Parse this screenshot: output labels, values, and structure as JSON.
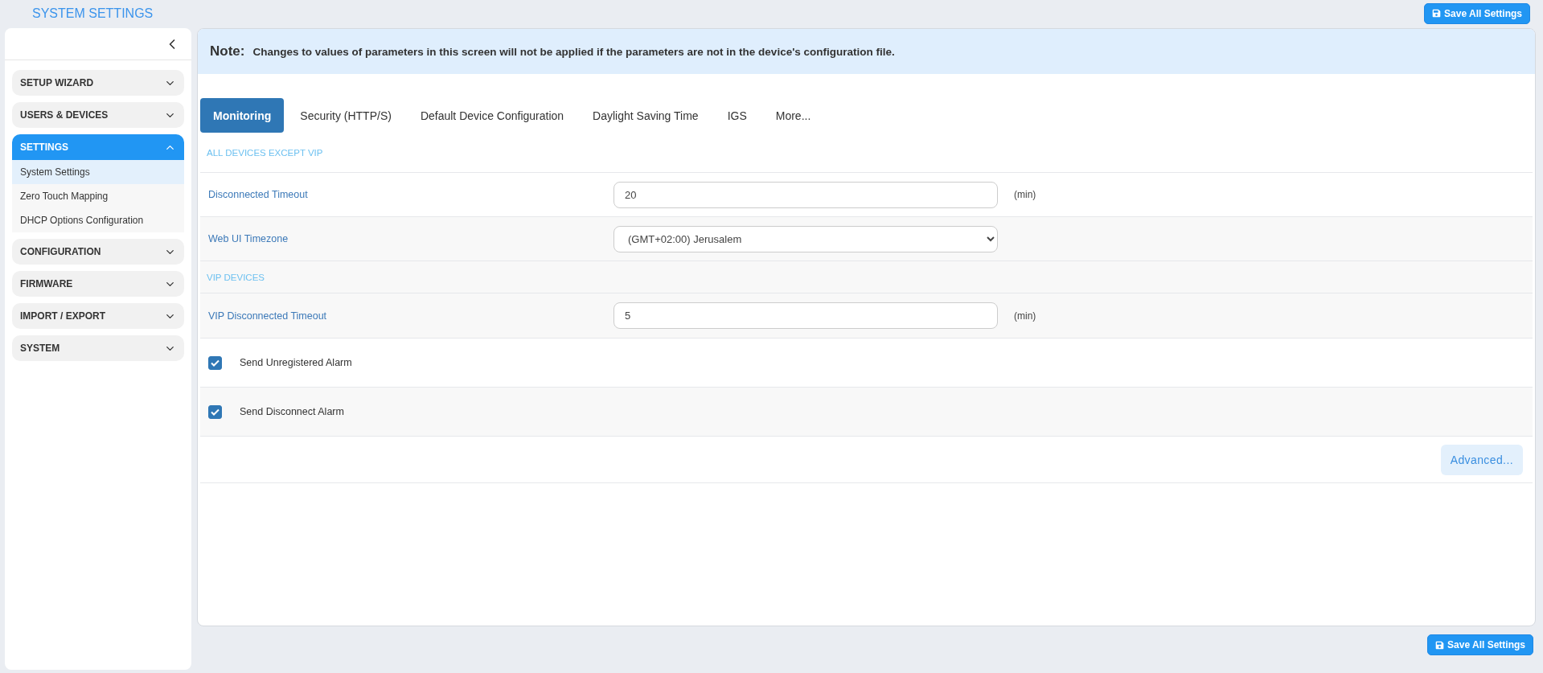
{
  "title": "SYSTEM SETTINGS",
  "save_top": "Save All Settings",
  "sidebar": {
    "groups": [
      {
        "label": "SETUP WIZARD",
        "expanded": false
      },
      {
        "label": "USERS & DEVICES",
        "expanded": false
      },
      {
        "label": "SETTINGS",
        "expanded": true,
        "items": [
          {
            "label": "System Settings",
            "selected": true
          },
          {
            "label": "Zero Touch Mapping",
            "selected": false
          },
          {
            "label": "DHCP Options Configuration",
            "selected": false
          }
        ]
      },
      {
        "label": "CONFIGURATION",
        "expanded": false
      },
      {
        "label": "FIRMWARE",
        "expanded": false
      },
      {
        "label": "IMPORT / EXPORT",
        "expanded": false
      },
      {
        "label": "SYSTEM",
        "expanded": false
      }
    ]
  },
  "note": {
    "label": "Note:",
    "text": "Changes to values of parameters in this screen will not be applied if the parameters are not in the device's configuration file."
  },
  "tabs": [
    {
      "label": "Monitoring",
      "selected": true
    },
    {
      "label": "Security (HTTP/S)",
      "selected": false
    },
    {
      "label": "Default Device Configuration",
      "selected": false
    },
    {
      "label": "Daylight Saving Time",
      "selected": false
    },
    {
      "label": "IGS",
      "selected": false
    },
    {
      "label": "More...",
      "selected": false
    }
  ],
  "rows": [
    {
      "kind": "section",
      "label": "ALL DEVICES EXCEPT VIP"
    },
    {
      "kind": "input",
      "label": "Disconnected Timeout",
      "value": "20",
      "unit": "(min)"
    },
    {
      "kind": "select",
      "label": "Web UI Timezone",
      "value": "(GMT+02:00) Jerusalem"
    },
    {
      "kind": "section",
      "label": "VIP DEVICES"
    },
    {
      "kind": "input",
      "label": "VIP Disconnected Timeout",
      "value": "5",
      "unit": "(min)"
    },
    {
      "kind": "checkbox",
      "label": "Send Unregistered Alarm",
      "checked": true
    },
    {
      "kind": "checkbox",
      "label": "Send Disconnect Alarm",
      "checked": true
    }
  ],
  "advanced": "Advanced...",
  "save_bottom": "Save All Settings"
}
